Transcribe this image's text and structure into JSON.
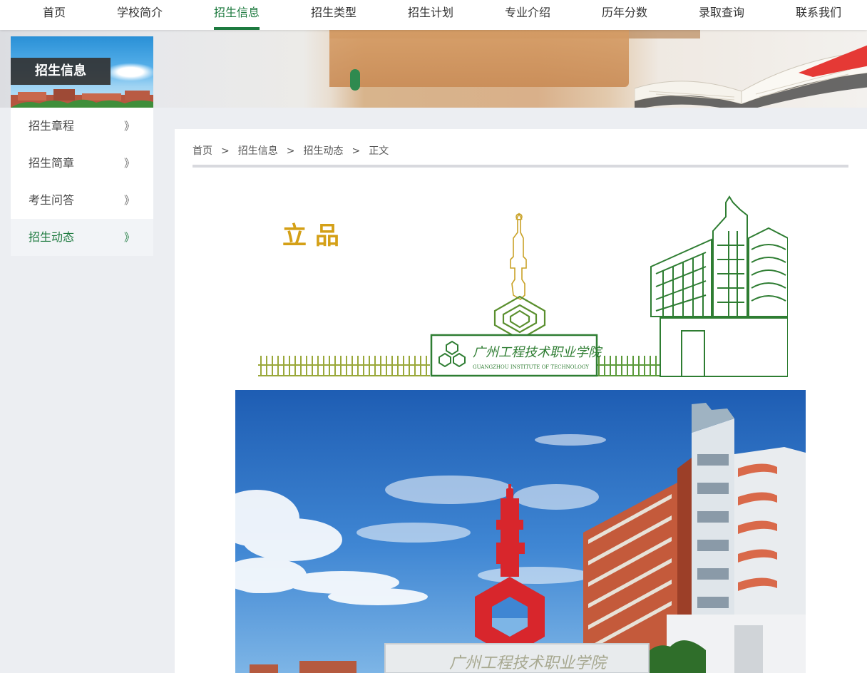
{
  "nav": {
    "items": [
      {
        "label": "首页"
      },
      {
        "label": "学校简介"
      },
      {
        "label": "招生信息"
      },
      {
        "label": "招生类型"
      },
      {
        "label": "招生计划"
      },
      {
        "label": "专业介绍"
      },
      {
        "label": "历年分数"
      },
      {
        "label": "录取查询"
      },
      {
        "label": "联系我们"
      }
    ],
    "active_index": 2,
    "accent_color": "#1d7a3f"
  },
  "sidebar": {
    "title": "招生信息",
    "items": [
      {
        "label": "招生章程",
        "chevron": "》"
      },
      {
        "label": "招生简章",
        "chevron": "》"
      },
      {
        "label": "考生问答",
        "chevron": "》"
      },
      {
        "label": "招生动态",
        "chevron": "》"
      }
    ],
    "active_index": 3
  },
  "breadcrumb": {
    "items": [
      "首页",
      "招生信息",
      "招生动态",
      "正文"
    ],
    "separator": ">"
  },
  "article": {
    "illustration": {
      "heading": "立 品",
      "plaque_text": "广州工程技术职业学院",
      "plaque_subtext": "GUANGZHOU INSTITUTE OF TECHNOLOGY"
    },
    "photo": {
      "gate_text": "广州工程技术职业学院"
    }
  },
  "colors": {
    "accent": "#1d7a3f",
    "illustration_green": "#2e7d32",
    "illustration_gold": "#c9a227",
    "heading_gold": "#d4a017",
    "sculpture_red": "#d8262c"
  }
}
